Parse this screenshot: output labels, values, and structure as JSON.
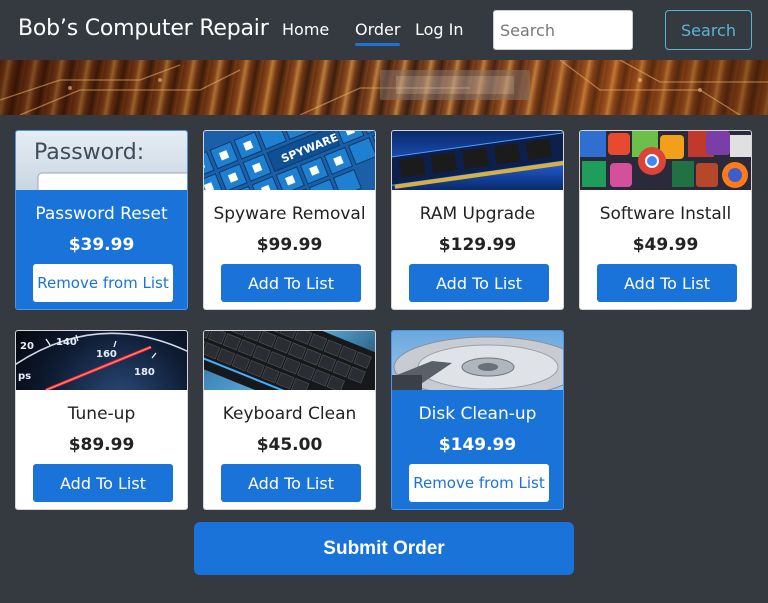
{
  "brand": "Bob’s Computer Repair",
  "nav": {
    "home": "Home",
    "order": "Order",
    "login": "Log In",
    "active": "Order"
  },
  "search": {
    "placeholder": "Search",
    "value": "",
    "button_label": "Search"
  },
  "products": [
    {
      "name": "Password Reset",
      "price": "$39.99",
      "button": "Remove from List",
      "selected": true,
      "image": "password-field-image"
    },
    {
      "name": "Spyware Removal",
      "price": "$99.99",
      "button": "Add To List",
      "selected": false,
      "image": "spyware-keyboard-image"
    },
    {
      "name": "RAM Upgrade",
      "price": "$129.99",
      "button": "Add To List",
      "selected": false,
      "image": "ram-module-image"
    },
    {
      "name": "Software Install",
      "price": "$49.99",
      "button": "Add To List",
      "selected": false,
      "image": "software-icons-image"
    },
    {
      "name": "Tune-up",
      "price": "$89.99",
      "button": "Add To List",
      "selected": false,
      "image": "speedometer-image"
    },
    {
      "name": "Keyboard Clean",
      "price": "$45.00",
      "button": "Add To List",
      "selected": false,
      "image": "keyboard-image"
    },
    {
      "name": "Disk Clean-up",
      "price": "$149.99",
      "button": "Remove from List",
      "selected": true,
      "image": "hard-disk-image"
    }
  ],
  "submit_label": "Submit Order",
  "colors": {
    "background": "#343a40",
    "accent": "#1a73d9",
    "search_outline": "#5ab4d8",
    "card": "#ffffff"
  },
  "thumb_labels": {
    "password": "Password:",
    "spyware": "SPYWARE",
    "gauge_ticks": [
      "20",
      "140",
      "160",
      "180",
      "ps"
    ]
  }
}
